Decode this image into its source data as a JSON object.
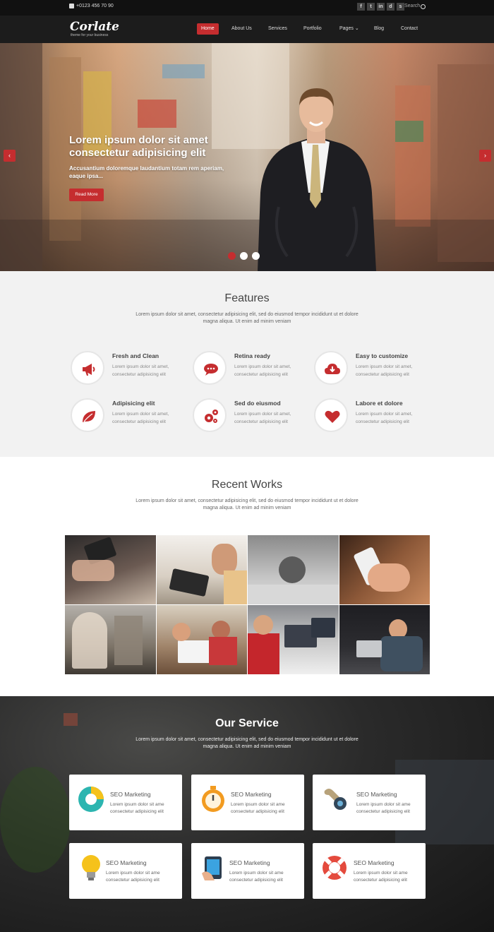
{
  "topbar": {
    "phone": "+0123 456 70 90",
    "socials": [
      "f",
      "t",
      "in",
      "d",
      "s"
    ],
    "search_label": "Search"
  },
  "nav": {
    "logo": "Corlate",
    "tagline": "theme for your business",
    "items": [
      "Home",
      "About Us",
      "Services",
      "Portfolio",
      "Pages",
      "Blog",
      "Contact"
    ],
    "active": "Home"
  },
  "hero": {
    "title": "Lorem ipsum dolor sit amet consectetur adipisicing elit",
    "subtitle": "Accusantium doloremque laudantium totam rem aperiam, eaque ipsa...",
    "button": "Read More",
    "prev": "‹",
    "next": "›"
  },
  "features": {
    "title": "Features",
    "desc": "Lorem ipsum dolor sit amet, consectetur adipisicing elit, sed do eiusmod tempor incididunt ut et dolore magna aliqua. Ut enim ad minim veniam",
    "items": [
      {
        "title": "Fresh and Clean",
        "text": "Lorem ipsum dolor sit amet, consectetur adipisicing elit",
        "icon": "megaphone-icon"
      },
      {
        "title": "Retina ready",
        "text": "Lorem ipsum dolor sit amet, consectetur adipisicing elit",
        "icon": "chat-icon"
      },
      {
        "title": "Easy to customize",
        "text": "Lorem ipsum dolor sit amet, consectetur adipisicing elit",
        "icon": "cloud-download-icon"
      },
      {
        "title": "Adipisicing elit",
        "text": "Lorem ipsum dolor sit amet, consectetur adipisicing elit",
        "icon": "leaf-icon"
      },
      {
        "title": "Sed do eiusmod",
        "text": "Lorem ipsum dolor sit amet, consectetur adipisicing elit",
        "icon": "gears-icon"
      },
      {
        "title": "Labore et dolore",
        "text": "Lorem ipsum dolor sit amet, consectetur adipisicing elit",
        "icon": "heart-icon"
      }
    ]
  },
  "works": {
    "title": "Recent Works",
    "desc": "Lorem ipsum dolor sit amet, consectetur adipisicing elit, sed do eiusmod tempor incididunt ut et dolore magna aliqua. Ut enim ad minim veniam"
  },
  "services": {
    "title": "Our Service",
    "desc": "Lorem ipsum dolor sit amet, consectetur adipisicing elit, sed do eiusmod tempor incididunt ut et dolore magna aliqua. Ut enim ad minim veniam",
    "cards": [
      {
        "title": "SEO Marketing",
        "text": "Lorem ipsum dolor sit ame consectetur adipisicing elit",
        "icon": "pie-chart-icon"
      },
      {
        "title": "SEO Marketing",
        "text": "Lorem ipsum dolor sit ame consectetur adipisicing elit",
        "icon": "stopwatch-icon"
      },
      {
        "title": "SEO Marketing",
        "text": "Lorem ipsum dolor sit ame consectetur adipisicing elit",
        "icon": "wrench-icon"
      },
      {
        "title": "SEO Marketing",
        "text": "Lorem ipsum dolor sit ame consectetur adipisicing elit",
        "icon": "lightbulb-icon"
      },
      {
        "title": "SEO Marketing",
        "text": "Lorem ipsum dolor sit ame consectetur adipisicing elit",
        "icon": "tablet-icon"
      },
      {
        "title": "SEO Marketing",
        "text": "Lorem ipsum dolor sit ame consectetur adipisicing elit",
        "icon": "lifebuoy-icon"
      }
    ]
  },
  "colors": {
    "accent": "#c52d2f",
    "dark": "#1c1c1c",
    "light_bg": "#f2f2f2"
  }
}
